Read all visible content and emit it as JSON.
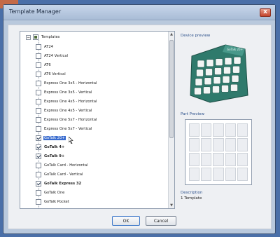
{
  "window": {
    "title": "Template Manager",
    "close_glyph": "x"
  },
  "tree": {
    "root_expander": "−",
    "root_label": "Templates",
    "items": [
      {
        "label": "AT24",
        "checked": false,
        "bold": false,
        "selected": false
      },
      {
        "label": "AT24 Vertical",
        "checked": false,
        "bold": false,
        "selected": false
      },
      {
        "label": "AT6",
        "checked": false,
        "bold": false,
        "selected": false
      },
      {
        "label": "AT6 Vertical",
        "checked": false,
        "bold": false,
        "selected": false
      },
      {
        "label": "Express One 3x5 - Horizontal",
        "checked": false,
        "bold": false,
        "selected": false
      },
      {
        "label": "Express One 3x5 - Vertical",
        "checked": false,
        "bold": false,
        "selected": false
      },
      {
        "label": "Express One 4x5 - Horizontal",
        "checked": false,
        "bold": false,
        "selected": false
      },
      {
        "label": "Express One 4x5 - Vertical",
        "checked": false,
        "bold": false,
        "selected": false
      },
      {
        "label": "Express One 5x7 - Horizontal",
        "checked": false,
        "bold": false,
        "selected": false
      },
      {
        "label": "Express One 5x7 - Vertical",
        "checked": false,
        "bold": false,
        "selected": false
      },
      {
        "label": "GoTalk 20+",
        "checked": true,
        "bold": false,
        "selected": true
      },
      {
        "label": "GoTalk 4+",
        "checked": true,
        "bold": true,
        "selected": false
      },
      {
        "label": "GoTalk 9+",
        "checked": true,
        "bold": true,
        "selected": false
      },
      {
        "label": "GoTalk Card - Horizontal",
        "checked": false,
        "bold": false,
        "selected": false
      },
      {
        "label": "GoTalk Card - Vertical",
        "checked": false,
        "bold": false,
        "selected": false
      },
      {
        "label": "GoTalk Express 32",
        "checked": true,
        "bold": true,
        "selected": false
      },
      {
        "label": "GoTalk One",
        "checked": false,
        "bold": false,
        "selected": false
      },
      {
        "label": "GoTalk Pocket",
        "checked": false,
        "bold": false,
        "selected": false
      }
    ]
  },
  "right": {
    "device_preview_label": "Device preview",
    "device_brand": "GoTalk 20+",
    "part_preview_label": "Part Preview",
    "description_label": "Description",
    "description_value": "1 Template"
  },
  "buttons": {
    "ok": "OK",
    "cancel": "Cancel"
  },
  "colors": {
    "accent": "#c46a48",
    "device_green": "#2f7a6c",
    "selection": "#3a6ccf"
  }
}
